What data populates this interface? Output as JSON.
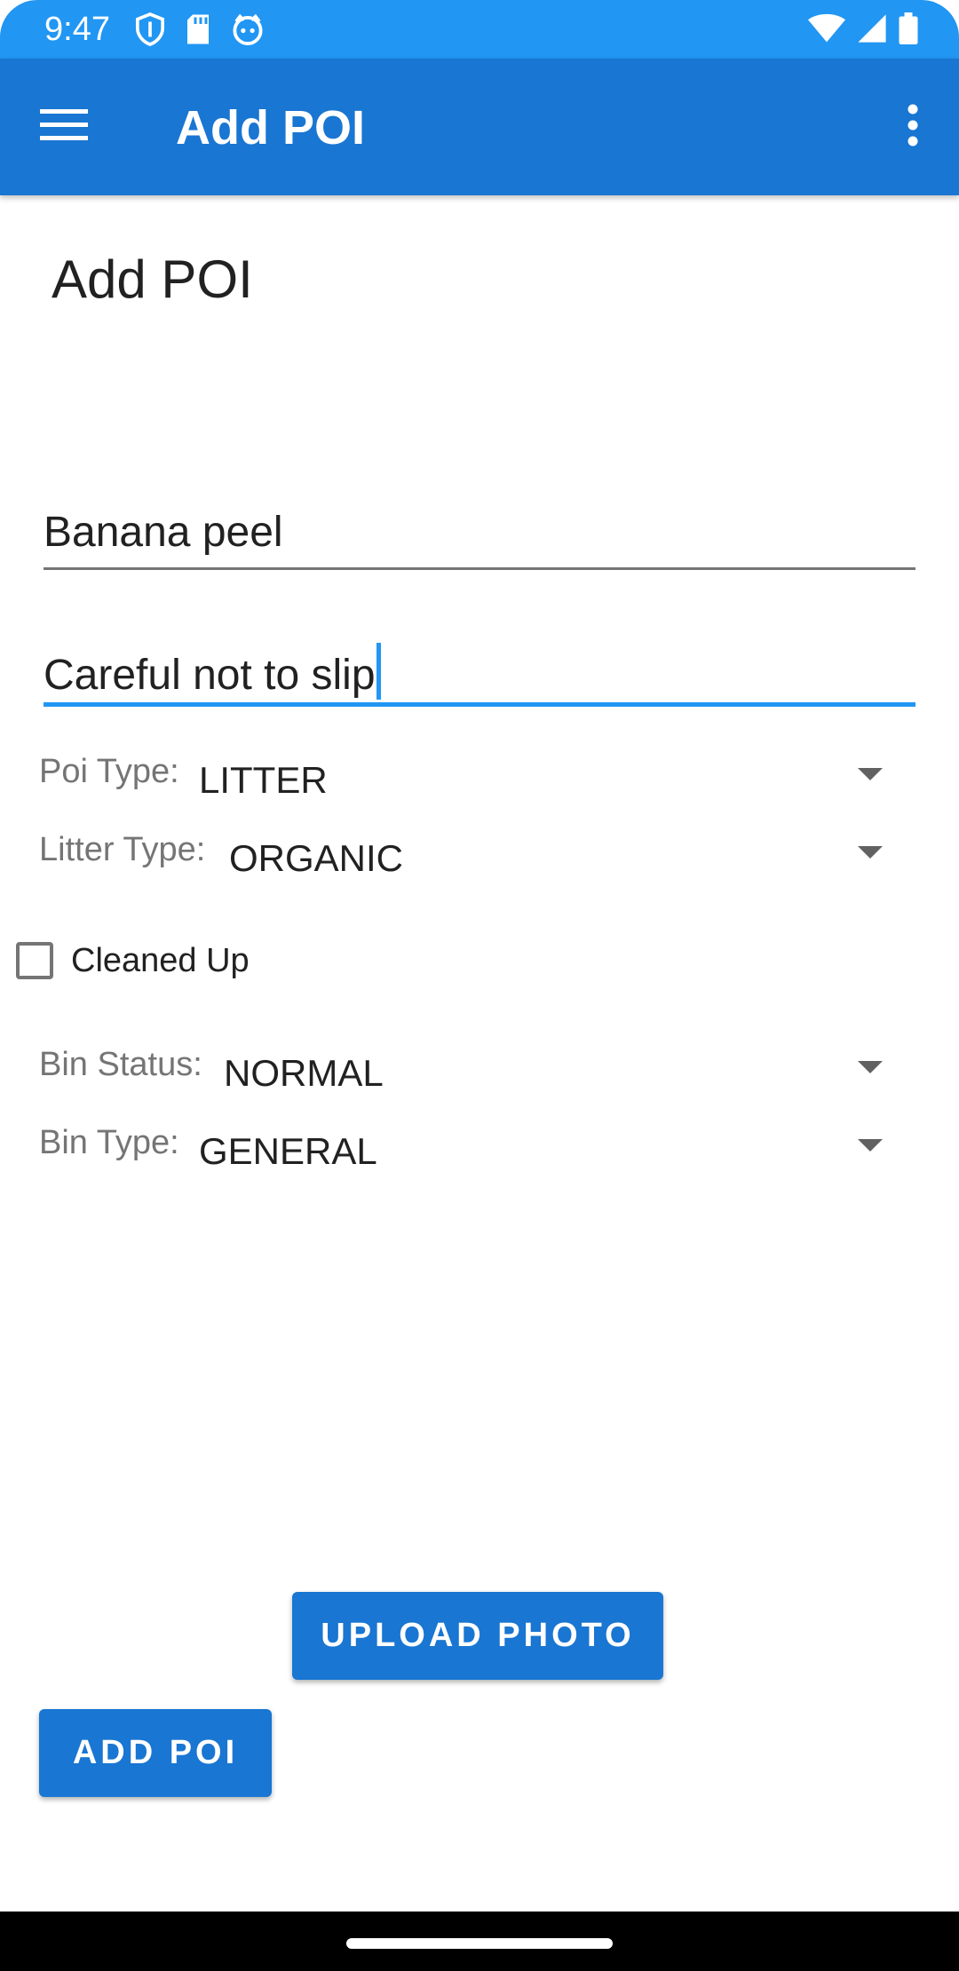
{
  "status_bar": {
    "time": "9:47",
    "left_icons": [
      "shield-icon",
      "sd-card-icon",
      "cat-face-icon"
    ],
    "right_icons": [
      "wifi-icon",
      "signal-icon",
      "battery-icon"
    ],
    "color": "#2196F3"
  },
  "app_bar": {
    "title": "Add POI",
    "color": "#1976D2",
    "menu_icon": "hamburger-menu-icon",
    "overflow_icon": "more-vert-icon"
  },
  "form": {
    "heading": "Add POI",
    "name_value": "Banana peel",
    "description_value": "Careful not to slip",
    "poi_type": {
      "label": "Poi Type:",
      "value": "LITTER"
    },
    "litter_type": {
      "label": "Litter Type:",
      "value": "ORGANIC"
    },
    "cleaned_up": {
      "label": "Cleaned Up",
      "checked": false
    },
    "bin_status": {
      "label": "Bin Status:",
      "value": "NORMAL"
    },
    "bin_type": {
      "label": "Bin Type:",
      "value": "GENERAL"
    }
  },
  "buttons": {
    "upload_photo": "UPLOAD PHOTO",
    "add_poi": "ADD POI"
  },
  "accent_color": "#2196F3"
}
